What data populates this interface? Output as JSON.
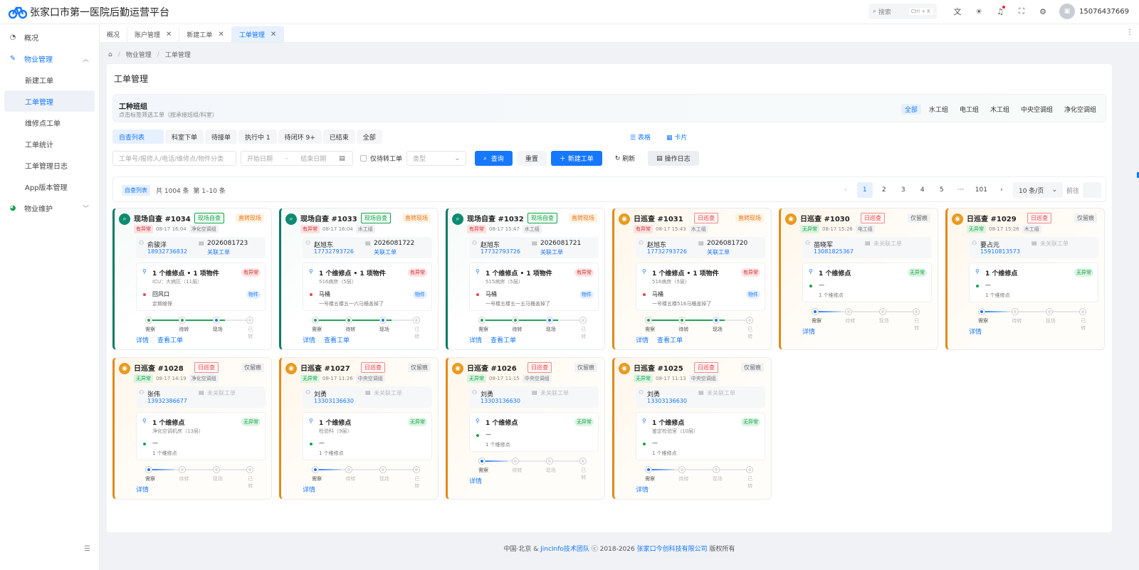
{
  "app": {
    "title": "张家口市第一医院后勤运营平台",
    "search_placeholder": "搜索",
    "search_kbd": "Ctrl + K",
    "username": "15076437669"
  },
  "colors": {
    "primary": "#1677ff",
    "green": "#0d7a66",
    "orange": "#e08a1c"
  },
  "sidebar": {
    "items": [
      {
        "label": "概况",
        "icon": "dashboard-icon"
      },
      {
        "label": "物业管理",
        "icon": "wrench-icon",
        "open": true
      },
      {
        "label": "新建工单"
      },
      {
        "label": "工单管理",
        "active": true
      },
      {
        "label": "维修点工单"
      },
      {
        "label": "工单统计"
      },
      {
        "label": "工单管理日志"
      },
      {
        "label": "App版本管理"
      },
      {
        "label": "物业维护",
        "icon": "pie-icon"
      }
    ]
  },
  "tabs": [
    {
      "label": "概况"
    },
    {
      "label": "账户管理"
    },
    {
      "label": "新建工单"
    },
    {
      "label": "工单管理",
      "active": true
    }
  ],
  "breadcrumb": [
    "物业管理",
    "工单管理"
  ],
  "page": {
    "title": "工单管理"
  },
  "group": {
    "title": "工种班组",
    "subtitle": "点击标签筛选工单（按承接班组/科室）",
    "options": [
      "全部",
      "水工组",
      "电工组",
      "木工组",
      "中央空调组",
      "净化空调组"
    ]
  },
  "status_tabs": [
    "自查列表",
    "科室下单",
    "待接单",
    "执行中 1",
    "待闭环 9+",
    "已结束",
    "全部"
  ],
  "views": {
    "table": "表格",
    "card": "卡片"
  },
  "filters": {
    "keyword_placeholder": "工单号/报修人/电话/维修点/物件分类",
    "start_placeholder": "开始日期",
    "end_placeholder": "结束日期",
    "range_sep": "-",
    "only_transfer": "仅待转工单",
    "type_placeholder": "类型",
    "query": "查询",
    "reset": "重置",
    "new": "新建工单",
    "refresh": "刷新",
    "log": "操作日志"
  },
  "list": {
    "badge": "自查列表",
    "total": "共 1004 条",
    "range": "第 1–10 条"
  },
  "pager": {
    "pages": [
      "1",
      "2",
      "3",
      "4",
      "5",
      "···",
      "101"
    ],
    "size": "10 条/页",
    "goto": "前往"
  },
  "step_labels": [
    "需察",
    "待转",
    "现场",
    "已转"
  ],
  "cards": [
    {
      "title": "现场自查 #1034",
      "tag": "现场自查",
      "tag2": "直转现场",
      "status": "有异常",
      "time": "08-17 16:04",
      "group": "净化空调组",
      "name": "俞骏洋",
      "phone": "18932736832",
      "wo": "2026081723",
      "wolink": "关联工单",
      "point": "1 个维修点 • 1 项物件",
      "loc": "ICU：大病区（11层）",
      "abn": "有异常",
      "item": "回风口",
      "desc": "定期维保",
      "wtag": "物件",
      "progress": 0.75,
      "links": [
        "详情",
        "查看工单"
      ]
    },
    {
      "title": "现场自查 #1033",
      "tag": "现场自查",
      "tag2": "直转现场",
      "status": "有异常",
      "time": "08-17 16:04",
      "group": "水工组",
      "name": "赵旭东",
      "phone": "17732793726",
      "wo": "2026081722",
      "wolink": "关联工单",
      "point": "1 个维修点 • 1 项物件",
      "loc": "516病房（5层）",
      "abn": "有异常",
      "item": "马桶",
      "desc": "一号楼五楼五一六马桶盖掉了",
      "wtag": "物件",
      "progress": 0.75,
      "links": [
        "详情",
        "查看工单"
      ]
    },
    {
      "title": "现场自查 #1032",
      "tag": "现场自查",
      "tag2": "直转现场",
      "status": "有异常",
      "time": "08-17 15:47",
      "group": "水工组",
      "name": "赵旭东",
      "phone": "17732793726",
      "wo": "2026081721",
      "wolink": "关联工单",
      "point": "1 个维修点 • 1 项物件",
      "loc": "515病房（5层）",
      "abn": "有异常",
      "item": "马桶",
      "desc": "一号楼五楼五一五马桶盖掉了",
      "wtag": "物件",
      "progress": 0.75,
      "links": [
        "详情",
        "查看工单"
      ]
    },
    {
      "title": "日巡查 #1031",
      "tag": "日巡查",
      "tag2": "直转现场",
      "status": "有异常",
      "time": "08-17 15:43",
      "group": "水工组",
      "name": "赵旭东",
      "phone": "17732793726",
      "wo": "2026081720",
      "wolink": "关联工单",
      "point": "1 个维修点 • 1 项物件",
      "loc": "516病房（5层）",
      "abn": "有异常",
      "item": "马桶",
      "desc": "一号楼五楼516马桶盖掉了",
      "wtag": "物件",
      "progress": 0.75,
      "links": [
        "详情",
        "查看工单"
      ]
    },
    {
      "title": "日巡查 #1030",
      "tag": "日巡查",
      "tag2": "仅留痕",
      "status": "无异常",
      "time": "08-17 15:26",
      "group": "电工组",
      "name": "苗晓军",
      "phone": "13081825367",
      "wo": "未关联工单",
      "point": "1 个维修点",
      "abn": "无异常",
      "item": "—",
      "desc": "1 个维修点",
      "progress": 0.25,
      "links": [
        "详情"
      ]
    },
    {
      "title": "日巡查 #1029",
      "tag": "日巡查",
      "tag2": "仅留痕",
      "status": "无异常",
      "time": "08-17 15:26",
      "group": "木工组",
      "name": "要占元",
      "phone": "15910813573",
      "wo": "未关联工单",
      "point": "1 个维修点",
      "abn": "无异常",
      "item": "—",
      "desc": "1 个维修点",
      "progress": 0.25,
      "links": [
        "详情"
      ]
    },
    {
      "title": "日巡查 #1028",
      "tag": "日巡查",
      "tag2": "仅留痕",
      "status": "无异常",
      "time": "08-17 14:19",
      "group": "净化空调组",
      "name": "张伟",
      "phone": "13932386677",
      "wo": "未关联工单",
      "point": "1 个维修点",
      "loc": "净化空调机房（13层）",
      "abn": "无异常",
      "item": "—",
      "desc": "1 个维修点",
      "progress": 0.25,
      "links": [
        "详情"
      ]
    },
    {
      "title": "日巡查 #1027",
      "tag": "日巡查",
      "tag2": "仅留痕",
      "status": "无异常",
      "time": "08-17 11:26",
      "group": "中央空调组",
      "name": "刘勇",
      "phone": "13303136630",
      "wo": "未关联工单",
      "point": "1 个维修点",
      "loc": "检验科（9层）",
      "abn": "无异常",
      "item": "—",
      "desc": "1 个维修点",
      "progress": 0.25,
      "links": [
        "详情"
      ]
    },
    {
      "title": "日巡查 #1026",
      "tag": "日巡查",
      "tag2": "仅留痕",
      "status": "无异常",
      "time": "08-17 11:15",
      "group": "中央空调组",
      "name": "刘勇",
      "phone": "13303136630",
      "wo": "未关联工单",
      "point": "1 个维修点",
      "abn": "无异常",
      "item": "—",
      "desc": "1 个维修点",
      "progress": 0.25,
      "links": [
        "详情"
      ]
    },
    {
      "title": "日巡查 #1025",
      "tag": "日巡查",
      "tag2": "仅留痕",
      "status": "无异常",
      "time": "08-17 11:13",
      "group": "中央空调组",
      "name": "刘勇",
      "phone": "13303136630",
      "wo": "未关联工单",
      "point": "1 个维修点",
      "loc": "鉴定检验室（10层）",
      "abn": "无异常",
      "item": "—",
      "desc": "1 个维修点",
      "progress": 0.25,
      "links": [
        "详情"
      ]
    }
  ],
  "footer": {
    "pre": "中国·北京 &",
    "team": "JincInfo技术团队",
    "mid": "ⓒ 2018-2026",
    "company": "张家口今创科技有限公司",
    "post": "版权所有"
  }
}
